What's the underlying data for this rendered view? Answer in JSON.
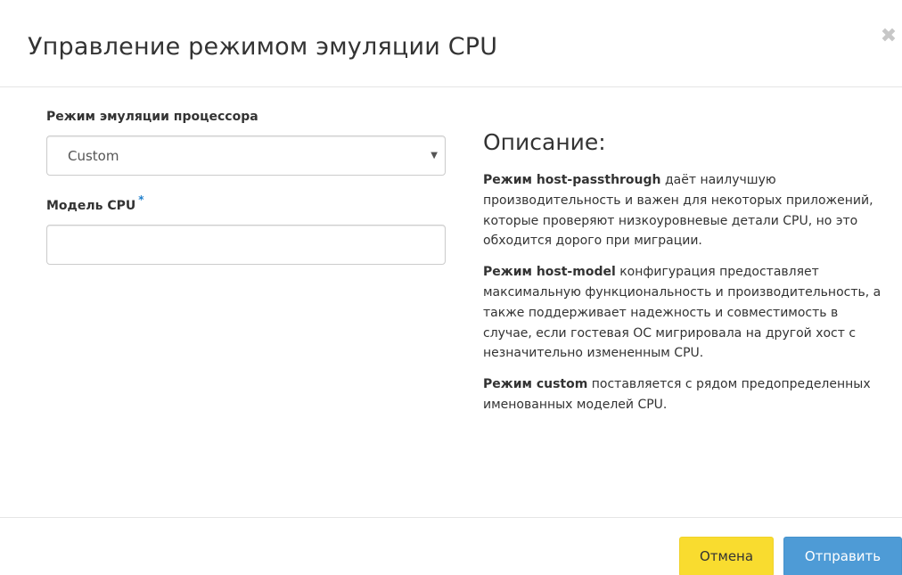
{
  "dialog": {
    "title": "Управление режимом эмуляции CPU",
    "close_icon": "close-icon"
  },
  "form": {
    "cpu_mode": {
      "label": "Режим эмуляции процессора",
      "selected": "Custom"
    },
    "cpu_model": {
      "label": "Модель CPU",
      "required_mark": "*",
      "value": ""
    }
  },
  "description": {
    "heading": "Описание:",
    "p1_strong": "Режим host-passthrough",
    "p1_text": " даёт наилучшую производительность и важен для некоторых приложений, которые проверяют низкоуровневые детали CPU, но это обходится дорого при миграции.",
    "p2_strong": "Режим host-model",
    "p2_text": " конфигурация предоставляет максимальную функциональность и производительность, а также поддерживает надежность и совместимость в случае, если гостевая ОС мигрировала на другой хост с незначительно измененным CPU.",
    "p3_strong": "Режим custom",
    "p3_text": " поставляется с рядом предопределенных именованных моделей CPU."
  },
  "footer": {
    "cancel_label": "Отмена",
    "submit_label": "Отправить"
  },
  "colors": {
    "cancel": "#f9dc2f",
    "submit": "#4e9bd6",
    "required": "#1f7fcc"
  }
}
